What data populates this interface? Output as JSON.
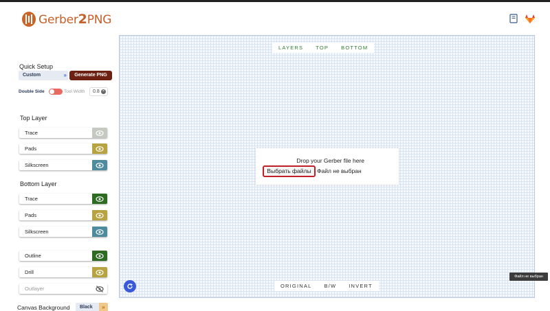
{
  "header": {
    "logo_text_a": "Gerber",
    "logo_text_b": "2",
    "logo_text_c": "PNG",
    "icons": [
      "book-icon",
      "gitlab-icon"
    ]
  },
  "quick_setup": {
    "title": "Quick Setup",
    "preset_value": "Custom",
    "generate_label": "Generate PNG",
    "double_side_label": "Double Side",
    "double_side_on": true,
    "tool_width_label": "Tool Width",
    "tool_width_value": "0.8"
  },
  "top_layer": {
    "title": "Top Layer",
    "items": [
      {
        "label": "Trace",
        "color": "#c5c9c1"
      },
      {
        "label": "Pads",
        "color": "#b7a33f"
      },
      {
        "label": "Silkscreen",
        "color": "#4e8c9d"
      }
    ]
  },
  "bottom_layer": {
    "title": "Bottom Layer",
    "items": [
      {
        "label": "Trace",
        "color": "#2d6a22"
      },
      {
        "label": "Pads",
        "color": "#b7a33f"
      },
      {
        "label": "Silkscreen",
        "color": "#4e8c9d"
      }
    ]
  },
  "other_layers": {
    "items": [
      {
        "label": "Outline",
        "color": "#2d6a22"
      },
      {
        "label": "Drill",
        "color": "#b7a33f"
      },
      {
        "label": "Outlayer",
        "color": "#ffffff"
      }
    ]
  },
  "canvas": {
    "view_tabs": [
      "LAYERS",
      "TOP",
      "BOTTOM"
    ],
    "render_tabs": [
      "ORIGINAL",
      "B/W",
      "INVERT"
    ],
    "drop_text": "Drop your Gerber file here",
    "file_button_label": "Выбрать файлы",
    "file_status": "Файл не выбран",
    "tooltip": "Файл не выбран"
  },
  "canvas_background": {
    "label": "Canvas Background",
    "value": "Black"
  }
}
